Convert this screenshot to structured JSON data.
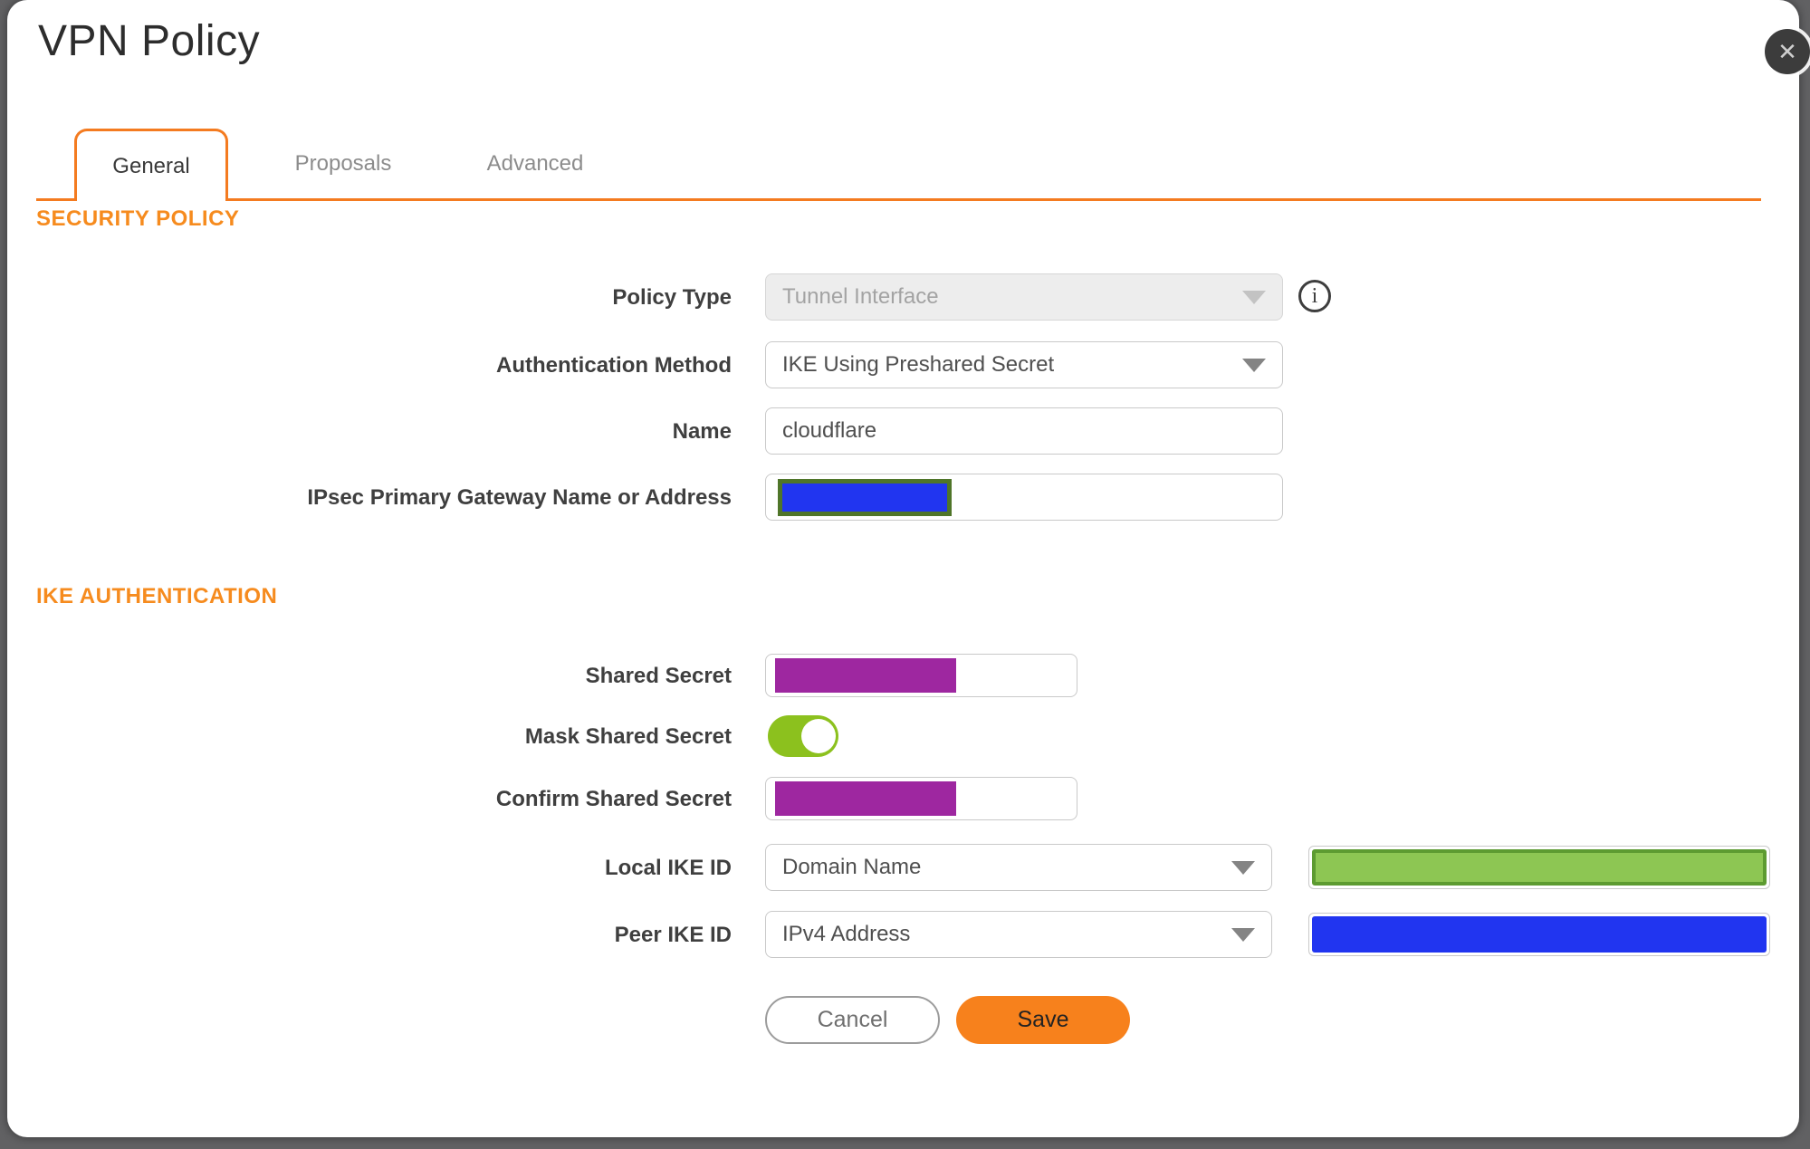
{
  "dialog": {
    "title": "VPN Policy"
  },
  "tabs": {
    "general": "General",
    "proposals": "Proposals",
    "advanced": "Advanced",
    "active_tab": "General"
  },
  "security_policy": {
    "heading": "SECURITY POLICY",
    "policy_type_label": "Policy Type",
    "policy_type_value": "Tunnel Interface",
    "policy_type_disabled": true,
    "auth_method_label": "Authentication Method",
    "auth_method_value": "IKE Using Preshared Secret",
    "name_label": "Name",
    "name_value": "cloudflare",
    "gateway_label": "IPsec Primary Gateway Name or Address",
    "gateway_value_redacted": true
  },
  "ike_authentication": {
    "heading": "IKE AUTHENTICATION",
    "shared_secret_label": "Shared Secret",
    "shared_secret_redacted": true,
    "mask_shared_secret_label": "Mask Shared Secret",
    "mask_shared_secret_on": true,
    "confirm_shared_secret_label": "Confirm Shared Secret",
    "confirm_shared_secret_redacted": true,
    "local_ike_id_label": "Local IKE ID",
    "local_ike_id_type": "Domain Name",
    "local_ike_id_value_redacted": true,
    "peer_ike_id_label": "Peer IKE ID",
    "peer_ike_id_type": "IPv4 Address",
    "peer_ike_id_value_redacted": true
  },
  "actions": {
    "cancel": "Cancel",
    "save": "Save"
  },
  "icons": {
    "close": "✕",
    "info": "i"
  },
  "colors": {
    "accent_orange": "#f47b20",
    "heading_orange": "#f68b1e",
    "toggle_green": "#8cc11e",
    "redaction_purple": "#9e27a0",
    "redaction_blue": "#2135f0",
    "redaction_green": "#8dc653",
    "redaction_green_border": "#5d9b31",
    "redaction_olive_border": "#4f7529"
  }
}
